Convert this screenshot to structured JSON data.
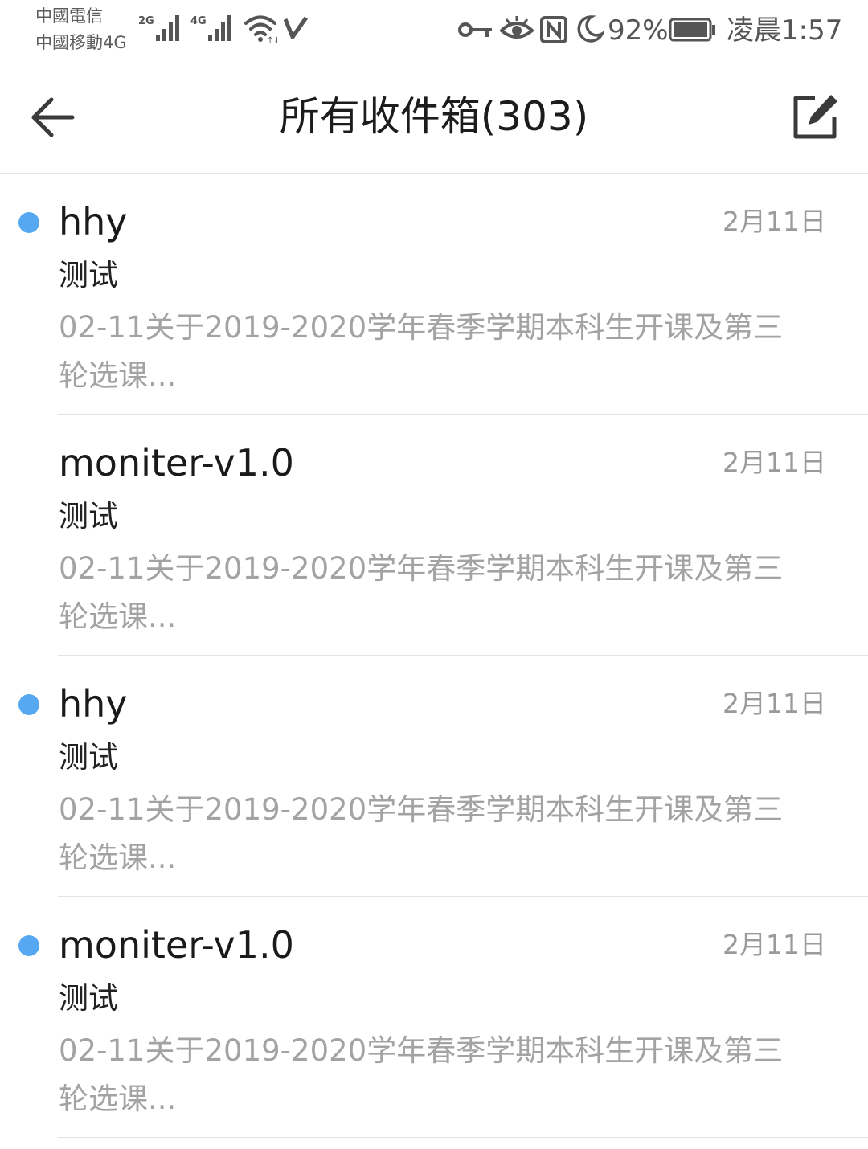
{
  "status_bar": {
    "carrier_1": "中國電信",
    "carrier_2": "中國移動4G",
    "sim1_network": "2G",
    "sim2_network": "4G",
    "battery": "92%",
    "time": "凌晨1:57",
    "icons": [
      "signal-icon",
      "signal-icon",
      "wifi-icon",
      "vpn-icon",
      "key-icon",
      "eye-icon",
      "nfc-icon",
      "moon-icon",
      "battery-icon"
    ]
  },
  "toolbar": {
    "back_icon": "arrow-left-icon",
    "title": "所有收件箱(303)",
    "compose_icon": "edit-icon"
  },
  "colors": {
    "unread_dot": "#55a8f1",
    "title_text": "#1c1c1c",
    "secondary_text": "#a3a3a3",
    "divider": "#e2e2e2"
  },
  "mails": [
    {
      "sender": "hhy",
      "date": "2月11日",
      "subject": "测试",
      "preview": "02-11关于2019-2020学年春季学期本科生开课及第三轮选课...",
      "unread": true
    },
    {
      "sender": "moniter-v1.0",
      "date": "2月11日",
      "subject": "测试",
      "preview": "02-11关于2019-2020学年春季学期本科生开课及第三轮选课...",
      "unread": false
    },
    {
      "sender": "hhy",
      "date": "2月11日",
      "subject": "测试",
      "preview": "02-11关于2019-2020学年春季学期本科生开课及第三轮选课...",
      "unread": true
    },
    {
      "sender": "moniter-v1.0",
      "date": "2月11日",
      "subject": "测试",
      "preview": "02-11关于2019-2020学年春季学期本科生开课及第三轮选课...",
      "unread": true
    }
  ]
}
